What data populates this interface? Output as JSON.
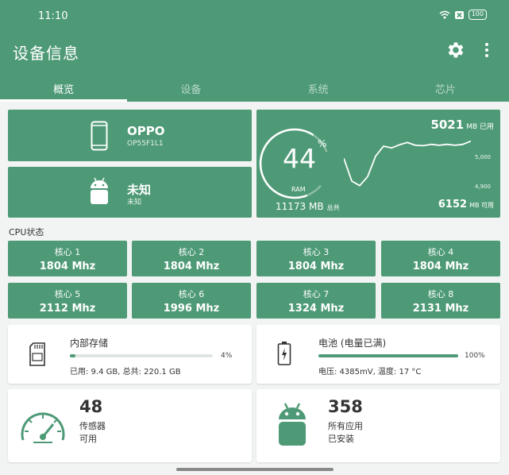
{
  "status": {
    "time": "11:10",
    "battery": "100"
  },
  "header": {
    "title": "设备信息"
  },
  "tabs": [
    "概览",
    "设备",
    "系统",
    "芯片"
  ],
  "device": {
    "brand": "OPPO",
    "model": "OP55F1L1",
    "name": "未知",
    "name_sub": "未知"
  },
  "ram": {
    "percent": "44",
    "percent_sign": "%",
    "label": "RAM",
    "used_value": "5021",
    "used_unit": "MB 已用",
    "total_value": "11173 MB",
    "total_unit": "总共",
    "avail_value": "6152",
    "avail_unit": "MB 可用",
    "tick_high": "5,000",
    "tick_low": "4,900",
    "usage_fraction": 0.44,
    "history_mb": [
      4985,
      4935,
      4925,
      4945,
      4990,
      5012,
      5008,
      5015,
      5020,
      5014,
      5013,
      5016,
      5014,
      5016,
      5014,
      5016,
      5023
    ]
  },
  "cpu": {
    "section_label": "CPU状态",
    "cores": [
      {
        "name": "核心 1",
        "freq": "1804 Mhz"
      },
      {
        "name": "核心 2",
        "freq": "1804 Mhz"
      },
      {
        "name": "核心 3",
        "freq": "1804 Mhz"
      },
      {
        "name": "核心 4",
        "freq": "1804 Mhz"
      },
      {
        "name": "核心 5",
        "freq": "2112 Mhz"
      },
      {
        "name": "核心 6",
        "freq": "1996 Mhz"
      },
      {
        "name": "核心 7",
        "freq": "1324 Mhz"
      },
      {
        "name": "核心 8",
        "freq": "2131 Mhz"
      }
    ]
  },
  "storage": {
    "title": "内部存储",
    "percent": "4%",
    "fill_fraction": 0.04,
    "detail": "已用: 9.4 GB, 总共: 220.1 GB"
  },
  "battery": {
    "title": "电池 (电量已满)",
    "percent": "100%",
    "fill_fraction": 1.0,
    "detail": "电压: 4385mV, 温度: 17 °C"
  },
  "sensors": {
    "count": "48",
    "line1": "传感器",
    "line2": "可用"
  },
  "apps": {
    "count": "358",
    "line1": "所有应用",
    "line2": "已安装"
  },
  "colors": {
    "primary": "#4e9a76",
    "background": "#f2f4f3",
    "track": "#dfe6e2"
  }
}
